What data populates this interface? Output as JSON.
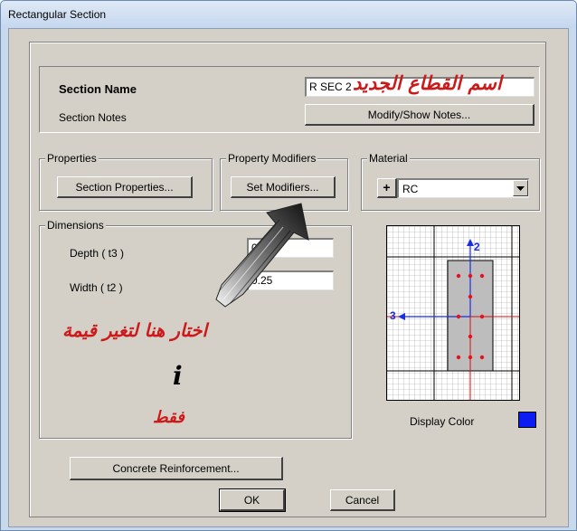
{
  "window": {
    "title": "Rectangular Section"
  },
  "section": {
    "name_label": "Section Name",
    "name_value": "R SEC 2",
    "name_annotation": "اسم القطاع الجديد",
    "notes_label": "Section Notes",
    "notes_button": "Modify/Show Notes..."
  },
  "properties": {
    "legend": "Properties",
    "button": "Section Properties..."
  },
  "modifiers": {
    "legend": "Property Modifiers",
    "button": "Set Modifiers..."
  },
  "material": {
    "legend": "Material",
    "add_button": "+",
    "selected": "RC"
  },
  "dimensions": {
    "legend": "Dimensions",
    "depth_label": "Depth  ( t3 )",
    "depth_value": "0.5",
    "width_label": "Width  ( t2 )",
    "width_value": "0.25"
  },
  "annotation": {
    "line1": "اختار هنا لتغير قيمة",
    "line2": "i",
    "line3": "فقط",
    "color": "#cc1a1a"
  },
  "preview": {
    "axis_2": "2",
    "axis_3": "3",
    "axis_color": "#1a2ee0",
    "bar_color": "#e8101a"
  },
  "display_color": {
    "label": "Display Color",
    "value": "#0a1cf2"
  },
  "buttons": {
    "reinforcement": "Concrete Reinforcement...",
    "ok": "OK",
    "cancel": "Cancel"
  }
}
